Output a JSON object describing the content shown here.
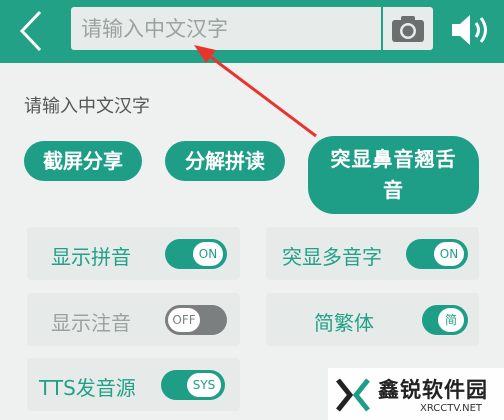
{
  "search": {
    "placeholder": "请输入中文汉字"
  },
  "section_label": "请输入中文汉字",
  "actions": {
    "screenshot_share": "截屏分享",
    "split_pinyin": "分解拼读",
    "highlight_nasal_retroflex_line1": "突显鼻音翘舌",
    "highlight_nasal_retroflex_line2": "音"
  },
  "options": {
    "show_pinyin": {
      "label": "显示拼音",
      "state": "ON"
    },
    "highlight_polyphone": {
      "label": "突显多音字",
      "state": "ON"
    },
    "show_zhuyin": {
      "label": "显示注音",
      "state": "OFF"
    },
    "simp_trad": {
      "label": "简繁体",
      "state": "简"
    },
    "tts_source": {
      "label": "TTS发音源",
      "state": "SYS"
    }
  },
  "watermark": {
    "brand": "鑫锐软件园",
    "url": "XRCCTV.NET"
  },
  "colors": {
    "primary": "#22a187",
    "toggle_off": "#7c7f80",
    "background": "#eef1f0",
    "annotation_arrow": "#e8352b"
  }
}
